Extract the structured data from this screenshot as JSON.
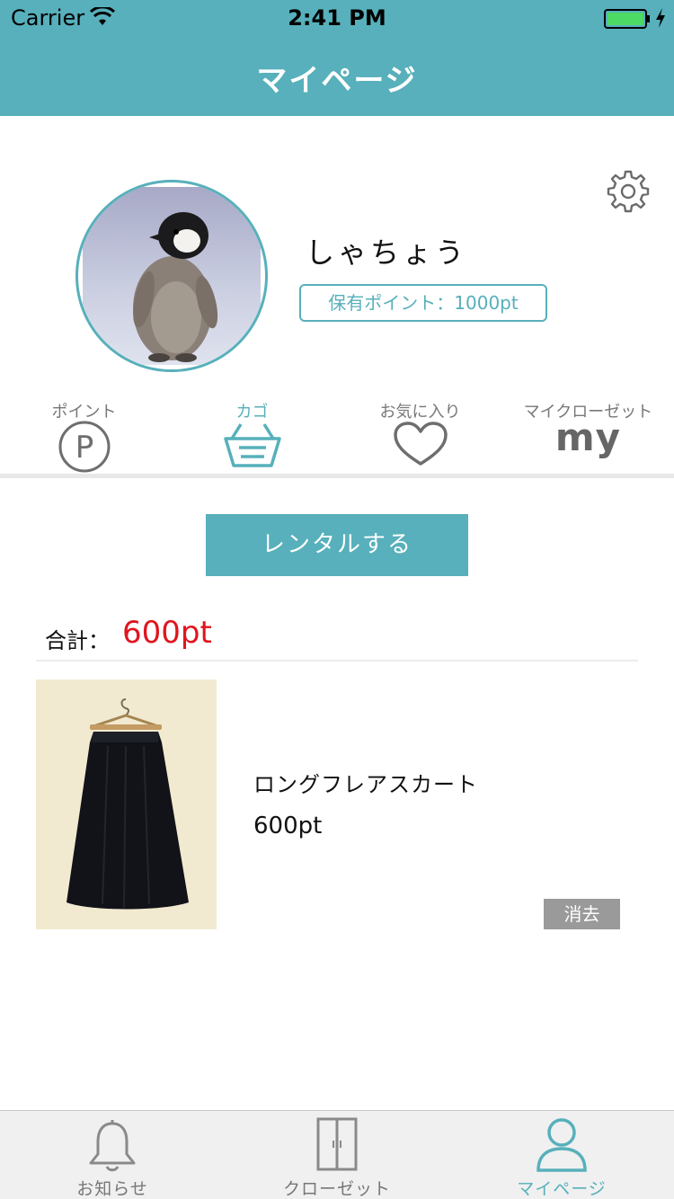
{
  "status_bar": {
    "carrier": "Carrier",
    "time": "2:41 PM"
  },
  "nav": {
    "title": "マイページ"
  },
  "profile": {
    "name": "しゃちょう",
    "points_badge": "保有ポイント：1000pt"
  },
  "tabs": [
    {
      "label": "ポイント",
      "icon": "point-icon"
    },
    {
      "label": "カゴ",
      "icon": "basket-icon",
      "active": true
    },
    {
      "label": "お気に入り",
      "icon": "heart-icon"
    },
    {
      "label": "マイクローゼット",
      "icon": "my-text-icon",
      "icon_text": "my"
    }
  ],
  "cart": {
    "rent_button": "レンタルする",
    "total_label": "合計：",
    "total_value": "600pt",
    "items": [
      {
        "name": "ロングフレアスカート",
        "price": "600pt",
        "delete_label": "消去"
      }
    ]
  },
  "tabbar": [
    {
      "label": "お知らせ",
      "icon": "bell-icon"
    },
    {
      "label": "クローゼット",
      "icon": "closet-icon"
    },
    {
      "label": "マイページ",
      "icon": "person-icon",
      "active": true
    }
  ],
  "colors": {
    "accent": "#57b0bb",
    "total": "#e0141e",
    "delete_bg": "#9a9a9a"
  }
}
